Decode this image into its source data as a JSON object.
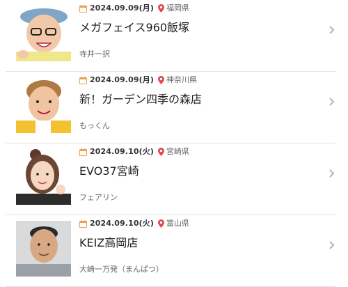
{
  "colors": {
    "calendar": "#f0a04b",
    "pin": "#e2474e",
    "divider": "#e2e2e2",
    "chevron": "#b5b5b5"
  },
  "events": [
    {
      "date": "2024.09.09(月)",
      "prefecture": "福岡県",
      "title": "メガフェイス960飯塚",
      "performer": "寺井一択"
    },
    {
      "date": "2024.09.09(月)",
      "prefecture": "神奈川県",
      "title": "新！ガーデン四季の森店",
      "performer": "もっくん"
    },
    {
      "date": "2024.09.10(火)",
      "prefecture": "宮崎県",
      "title": "EVO37宮崎",
      "performer": "フェアリン"
    },
    {
      "date": "2024.09.10(火)",
      "prefecture": "富山県",
      "title": "KEIZ高岡店",
      "performer": "大崎一万発（まんぱつ）"
    }
  ],
  "icons": {
    "date": "calendar-icon",
    "location": "map-pin-icon",
    "more": "chevron-right-icon"
  }
}
